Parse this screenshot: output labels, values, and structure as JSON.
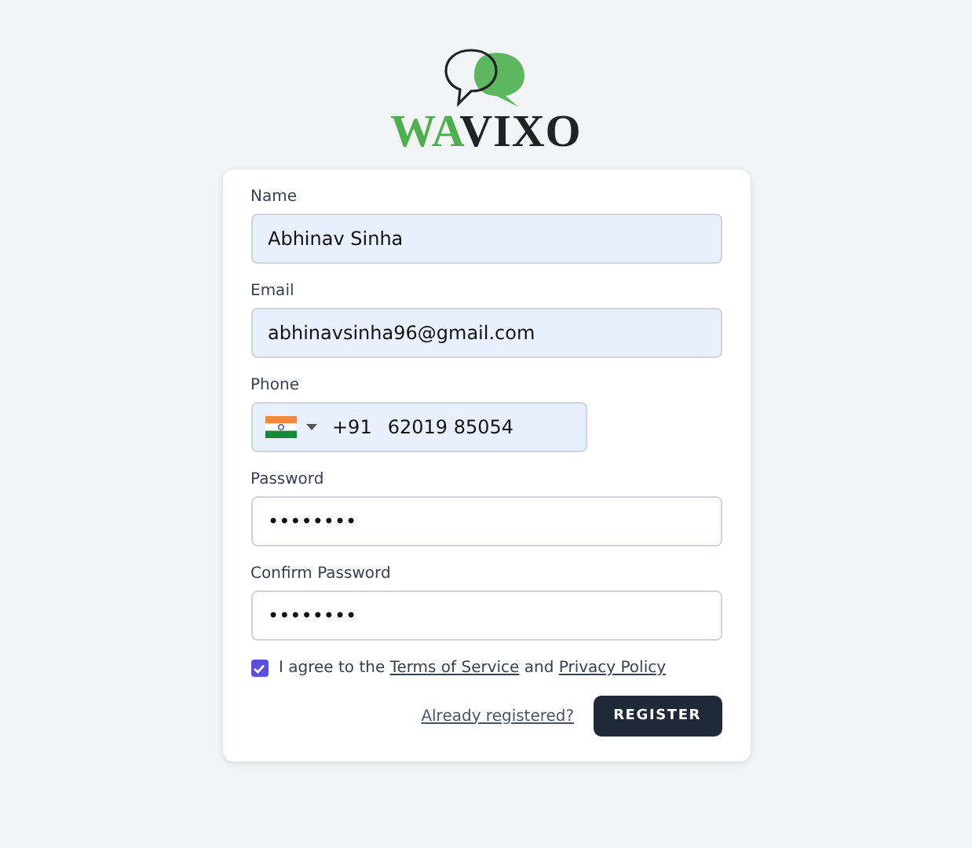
{
  "logo": {
    "part_1": "WA",
    "part_2": "VIXO"
  },
  "fields": [
    {
      "kind": "text",
      "label": "Name",
      "value": "Abhinav Sinha",
      "autofilled": true
    },
    {
      "kind": "text",
      "label": "Email",
      "value": "abhinavsinha96@gmail.com",
      "autofilled": true
    },
    {
      "kind": "phone",
      "label": "Phone",
      "code": "+91",
      "value": "62019 85054",
      "autofilled": true
    },
    {
      "kind": "text",
      "label": "Password",
      "value": "••••••••",
      "autofilled": false
    },
    {
      "kind": "text",
      "label": "Confirm Password",
      "value": "••••••••",
      "autofilled": false
    }
  ],
  "agreement": {
    "checked": true,
    "before": "I agree to the",
    "terms": "Terms of Service",
    "joiner": "and",
    "privacy": "Privacy Policy"
  },
  "login_link": "Already registered?",
  "submit": "REGISTER"
}
